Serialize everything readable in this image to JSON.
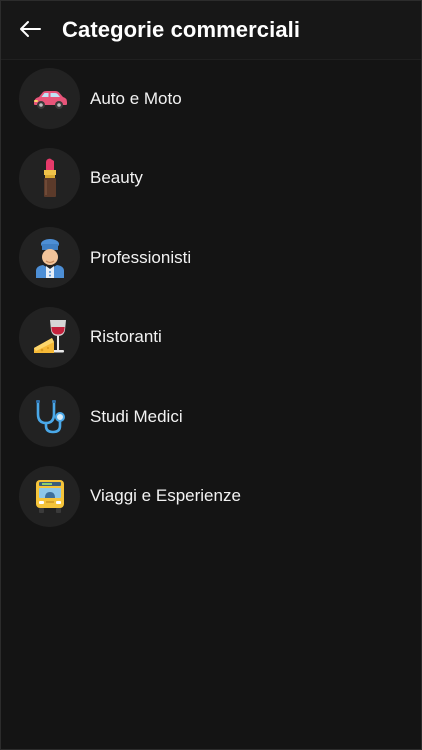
{
  "header": {
    "title": "Categorie commerciali",
    "back_icon": "arrow-left-icon"
  },
  "categories": [
    {
      "label": "Auto e Moto",
      "icon": "car-icon"
    },
    {
      "label": "Beauty",
      "icon": "lipstick-icon"
    },
    {
      "label": "Professionisti",
      "icon": "chef-icon"
    },
    {
      "label": "Ristoranti",
      "icon": "wine-cheese-icon"
    },
    {
      "label": "Studi Medici",
      "icon": "stethoscope-icon"
    },
    {
      "label": "Viaggi e Esperienze",
      "icon": "bus-icon"
    }
  ],
  "colors": {
    "background": "#141414",
    "icon_circle": "#222222",
    "text": "#ffffff"
  }
}
